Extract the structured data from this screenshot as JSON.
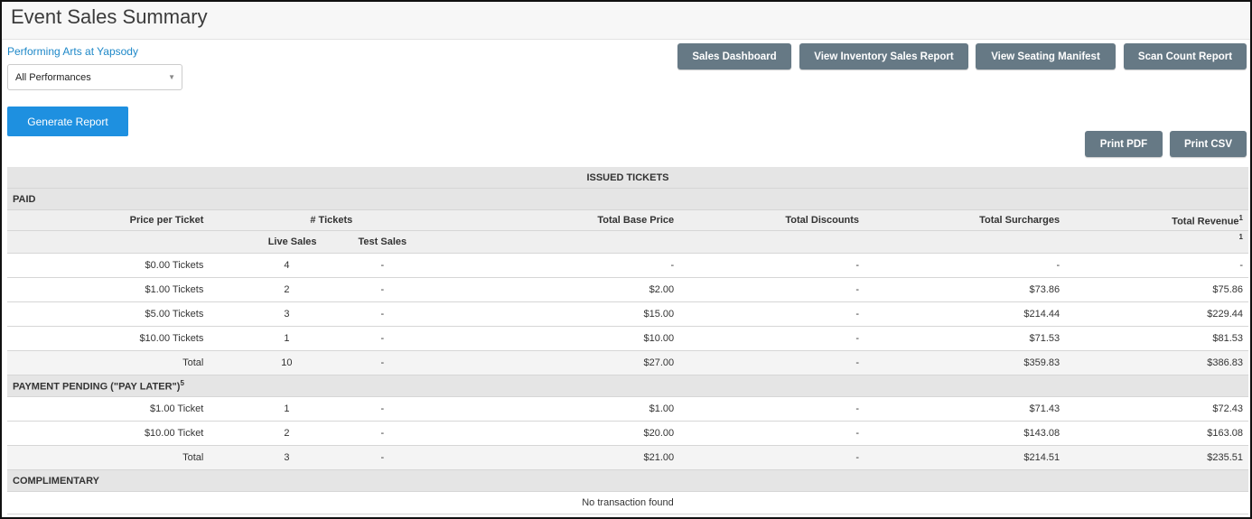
{
  "page": {
    "title": "Event Sales Summary",
    "org_link": "Performing Arts at Yapsody",
    "performance_select": "All Performances",
    "generate_button": "Generate Report"
  },
  "toolbar": {
    "sales_dashboard": "Sales Dashboard",
    "inventory_report": "View Inventory Sales Report",
    "seating_manifest": "View Seating Manifest",
    "scan_count": "Scan Count Report",
    "print_pdf": "Print PDF",
    "print_csv": "Print CSV"
  },
  "icons": {
    "select_caret": "chevron-down-icon"
  },
  "colors": {
    "primary": "#1e90e0",
    "secondary": "#667985",
    "link": "#1e88c8"
  },
  "report": {
    "title": "ISSUED TICKETS",
    "columns": {
      "price": "Price per Ticket",
      "tickets": "# Tickets",
      "live": "Live Sales",
      "test": "Test Sales",
      "base": "Total Base Price",
      "discounts": "Total Discounts",
      "surcharges": "Total Surcharges",
      "revenue": "Total Revenue",
      "revenue_sup": "1",
      "sub_sup": "1"
    },
    "paid": {
      "label": "PAID",
      "rows": [
        {
          "price": "$0.00 Tickets",
          "live": "4",
          "test": "-",
          "base": "-",
          "disc": "-",
          "sur": "-",
          "rev": "-"
        },
        {
          "price": "$1.00 Tickets",
          "live": "2",
          "test": "-",
          "base": "$2.00",
          "disc": "-",
          "sur": "$73.86",
          "rev": "$75.86"
        },
        {
          "price": "$5.00 Tickets",
          "live": "3",
          "test": "-",
          "base": "$15.00",
          "disc": "-",
          "sur": "$214.44",
          "rev": "$229.44"
        },
        {
          "price": "$10.00 Tickets",
          "live": "1",
          "test": "-",
          "base": "$10.00",
          "disc": "-",
          "sur": "$71.53",
          "rev": "$81.53"
        }
      ],
      "total": {
        "price": "Total",
        "live": "10",
        "test": "-",
        "base": "$27.00",
        "disc": "-",
        "sur": "$359.83",
        "rev": "$386.83"
      }
    },
    "pending": {
      "label": "PAYMENT PENDING (\"PAY LATER\")",
      "sup": "5",
      "rows": [
        {
          "price": "$1.00 Ticket",
          "live": "1",
          "test": "-",
          "base": "$1.00",
          "disc": "-",
          "sur": "$71.43",
          "rev": "$72.43"
        },
        {
          "price": "$10.00 Ticket",
          "live": "2",
          "test": "-",
          "base": "$20.00",
          "disc": "-",
          "sur": "$143.08",
          "rev": "$163.08"
        }
      ],
      "total": {
        "price": "Total",
        "live": "3",
        "test": "-",
        "base": "$21.00",
        "disc": "-",
        "sur": "$214.51",
        "rev": "$235.51"
      }
    },
    "complimentary": {
      "label": "COMPLIMENTARY",
      "empty": "No transaction found"
    }
  }
}
